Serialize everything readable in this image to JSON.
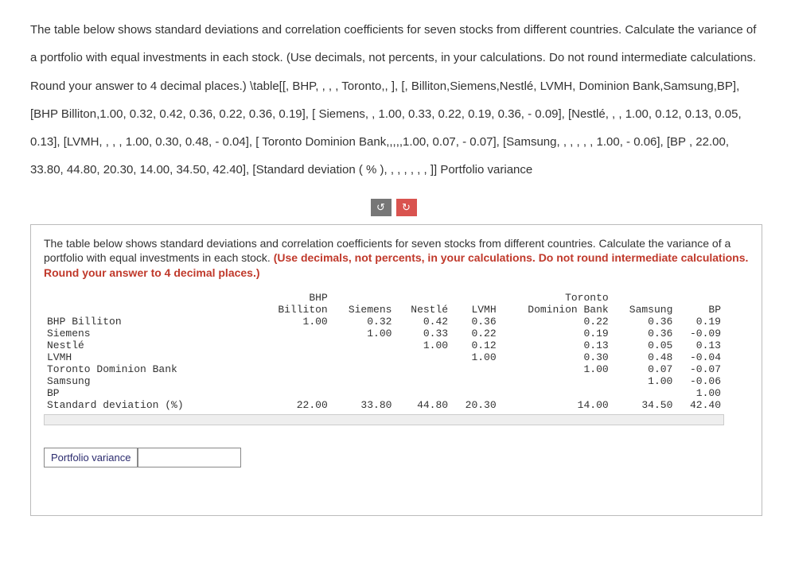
{
  "top_block": "The table below shows standard deviations and correlation coefficients for seven stocks from different countries. Calculate the variance of a portfolio with equal investments in each stock. (Use decimals, not percents, in your calculations. Do not round intermediate calculations. Round your answer to 4 decimal places.) \\table[[, BHP, , , , Toronto,, ], [, Billiton,Siemens,Nestlé, LVMH, Dominion Bank,Samsung,BP], [BHP Billiton,1.00, 0.32, 0.42, 0.36, 0.22, 0.36, 0.19], [ Siemens, , 1.00, 0.33, 0.22, 0.19, 0.36, - 0.09], [Nestlé, , , 1.00, 0.12, 0.13, 0.05, 0.13], [LVMH, , , , 1.00, 0.30, 0.48, - 0.04], [ Toronto Dominion Bank,,,,,1.00, 0.07, - 0.07], [Samsung, , , , , , 1.00, - 0.06], [BP , 22.00, 33.80, 44.80, 20.30, 14.00, 34.50, 42.40], [Standard deviation ( % ), , , , , , , ]] Portfolio variance",
  "instr_black": "The table below shows standard deviations and correlation coefficients for seven stocks from different countries. Calculate the variance of a portfolio with equal investments in each stock. ",
  "instr_red": "(Use decimals, not percents, in your calculations. Do not round intermediate calculations. Round your answer to 4 decimal places.)",
  "headers_top": [
    "",
    "BHP",
    "",
    "",
    "",
    "Toronto",
    "",
    ""
  ],
  "headers_bot": [
    "",
    "Billiton",
    "Siemens",
    "Nestlé",
    "LVMH",
    "Dominion Bank",
    "Samsung",
    "BP"
  ],
  "rows": [
    {
      "label": "BHP Billiton",
      "cells": [
        "1.00",
        "0.32",
        "0.42",
        "0.36",
        "0.22",
        "0.36",
        "0.19"
      ]
    },
    {
      "label": "Siemens",
      "cells": [
        "",
        "1.00",
        "0.33",
        "0.22",
        "0.19",
        "0.36",
        "-0.09"
      ]
    },
    {
      "label": "Nestlé",
      "cells": [
        "",
        "",
        "1.00",
        "0.12",
        "0.13",
        "0.05",
        "0.13"
      ]
    },
    {
      "label": "LVMH",
      "cells": [
        "",
        "",
        "",
        "1.00",
        "0.30",
        "0.48",
        "-0.04"
      ]
    },
    {
      "label": "Toronto Dominion Bank",
      "cells": [
        "",
        "",
        "",
        "",
        "1.00",
        "0.07",
        "-0.07"
      ]
    },
    {
      "label": "Samsung",
      "cells": [
        "",
        "",
        "",
        "",
        "",
        "1.00",
        "-0.06"
      ]
    },
    {
      "label": "BP",
      "cells": [
        "",
        "",
        "",
        "",
        "",
        "",
        "1.00"
      ]
    },
    {
      "label": "Standard deviation (%)",
      "cells": [
        "22.00",
        "33.80",
        "44.80",
        "20.30",
        "14.00",
        "34.50",
        "42.40"
      ]
    }
  ],
  "answer_label": "Portfolio variance",
  "answer_value": "",
  "icons": {
    "reset": "↻",
    "refresh": "↻"
  }
}
